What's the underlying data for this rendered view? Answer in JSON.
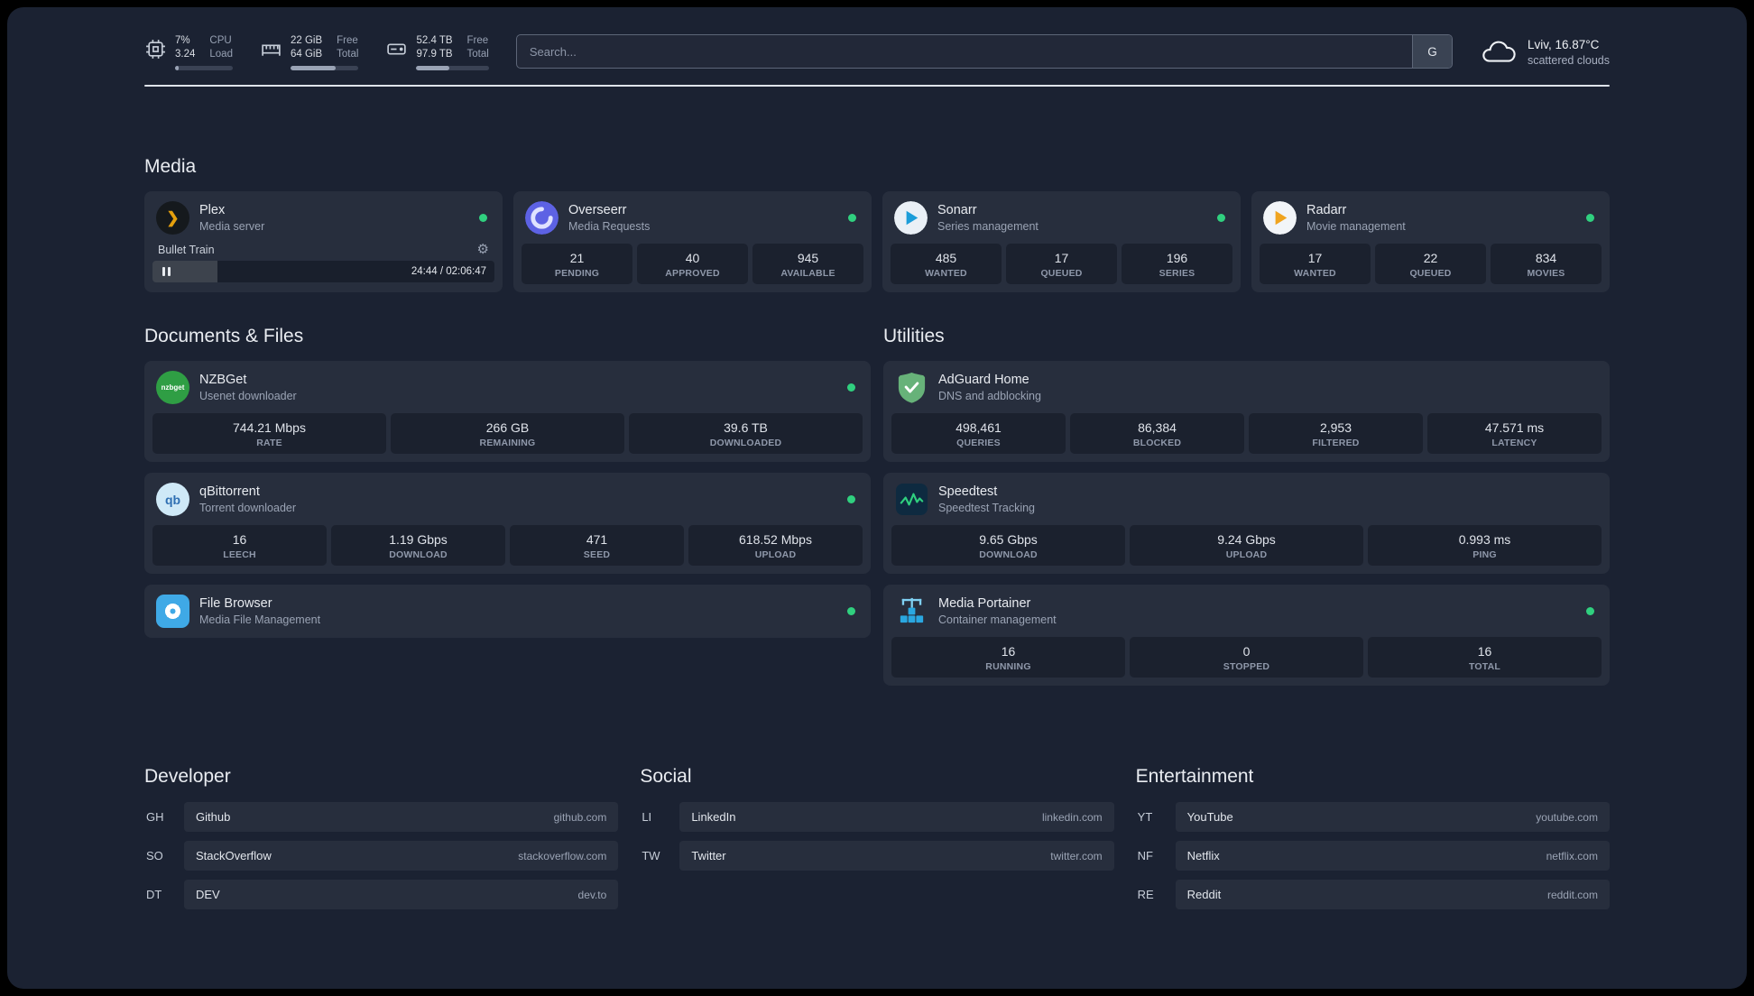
{
  "topbar": {
    "resources": [
      {
        "values": [
          "7%",
          "3.24"
        ],
        "labels": [
          "CPU",
          "Load"
        ],
        "percent": 7
      },
      {
        "values": [
          "22 GiB",
          "64 GiB"
        ],
        "labels": [
          "Free",
          "Total"
        ],
        "percent": 66
      },
      {
        "values": [
          "52.4 TB",
          "97.9 TB"
        ],
        "labels": [
          "Free",
          "Total"
        ],
        "percent": 46
      }
    ],
    "search": {
      "placeholder": "Search...",
      "button": "G"
    },
    "weather": {
      "location": "Lviv, 16.87°C",
      "condition": "scattered clouds"
    }
  },
  "media": {
    "title": "Media",
    "plex": {
      "name": "Plex",
      "desc": "Media server",
      "now_playing": {
        "title": "Bullet Train",
        "time": "24:44 / 02:06:47",
        "progress_percent": 19
      }
    },
    "overseerr": {
      "name": "Overseerr",
      "desc": "Media Requests",
      "stats": [
        {
          "value": "21",
          "label": "PENDING"
        },
        {
          "value": "40",
          "label": "APPROVED"
        },
        {
          "value": "945",
          "label": "AVAILABLE"
        }
      ]
    },
    "sonarr": {
      "name": "Sonarr",
      "desc": "Series management",
      "stats": [
        {
          "value": "485",
          "label": "WANTED"
        },
        {
          "value": "17",
          "label": "QUEUED"
        },
        {
          "value": "196",
          "label": "SERIES"
        }
      ]
    },
    "radarr": {
      "name": "Radarr",
      "desc": "Movie management",
      "stats": [
        {
          "value": "17",
          "label": "WANTED"
        },
        {
          "value": "22",
          "label": "QUEUED"
        },
        {
          "value": "834",
          "label": "MOVIES"
        }
      ]
    }
  },
  "documents": {
    "title": "Documents & Files",
    "nzbget": {
      "name": "NZBGet",
      "desc": "Usenet downloader",
      "stats": [
        {
          "value": "744.21 Mbps",
          "label": "RATE"
        },
        {
          "value": "266 GB",
          "label": "REMAINING"
        },
        {
          "value": "39.6 TB",
          "label": "DOWNLOADED"
        }
      ]
    },
    "qbittorrent": {
      "name": "qBittorrent",
      "desc": "Torrent downloader",
      "stats": [
        {
          "value": "16",
          "label": "LEECH"
        },
        {
          "value": "1.19 Gbps",
          "label": "DOWNLOAD"
        },
        {
          "value": "471",
          "label": "SEED"
        },
        {
          "value": "618.52 Mbps",
          "label": "UPLOAD"
        }
      ]
    },
    "filebrowser": {
      "name": "File Browser",
      "desc": "Media File Management"
    }
  },
  "utilities": {
    "title": "Utilities",
    "adguard": {
      "name": "AdGuard Home",
      "desc": "DNS and adblocking",
      "stats": [
        {
          "value": "498,461",
          "label": "QUERIES"
        },
        {
          "value": "86,384",
          "label": "BLOCKED"
        },
        {
          "value": "2,953",
          "label": "FILTERED"
        },
        {
          "value": "47.571 ms",
          "label": "LATENCY"
        }
      ]
    },
    "speedtest": {
      "name": "Speedtest",
      "desc": "Speedtest Tracking",
      "stats": [
        {
          "value": "9.65 Gbps",
          "label": "DOWNLOAD"
        },
        {
          "value": "9.24 Gbps",
          "label": "UPLOAD"
        },
        {
          "value": "0.993 ms",
          "label": "PING"
        }
      ]
    },
    "portainer": {
      "name": "Media Portainer",
      "desc": "Container management",
      "stats": [
        {
          "value": "16",
          "label": "RUNNING"
        },
        {
          "value": "0",
          "label": "STOPPED"
        },
        {
          "value": "16",
          "label": "TOTAL"
        }
      ]
    }
  },
  "bookmarks": {
    "developer": {
      "title": "Developer",
      "items": [
        {
          "abbr": "GH",
          "name": "Github",
          "url": "github.com"
        },
        {
          "abbr": "SO",
          "name": "StackOverflow",
          "url": "stackoverflow.com"
        },
        {
          "abbr": "DT",
          "name": "DEV",
          "url": "dev.to"
        }
      ]
    },
    "social": {
      "title": "Social",
      "items": [
        {
          "abbr": "LI",
          "name": "LinkedIn",
          "url": "linkedin.com"
        },
        {
          "abbr": "TW",
          "name": "Twitter",
          "url": "twitter.com"
        }
      ]
    },
    "entertainment": {
      "title": "Entertainment",
      "items": [
        {
          "abbr": "YT",
          "name": "YouTube",
          "url": "youtube.com"
        },
        {
          "abbr": "NF",
          "name": "Netflix",
          "url": "netflix.com"
        },
        {
          "abbr": "RE",
          "name": "Reddit",
          "url": "reddit.com"
        }
      ]
    }
  },
  "icons": {
    "plex_glyph": "❯",
    "gear_glyph": "⚙",
    "qb_text": "qb",
    "nzbget_text": "nzbget"
  }
}
